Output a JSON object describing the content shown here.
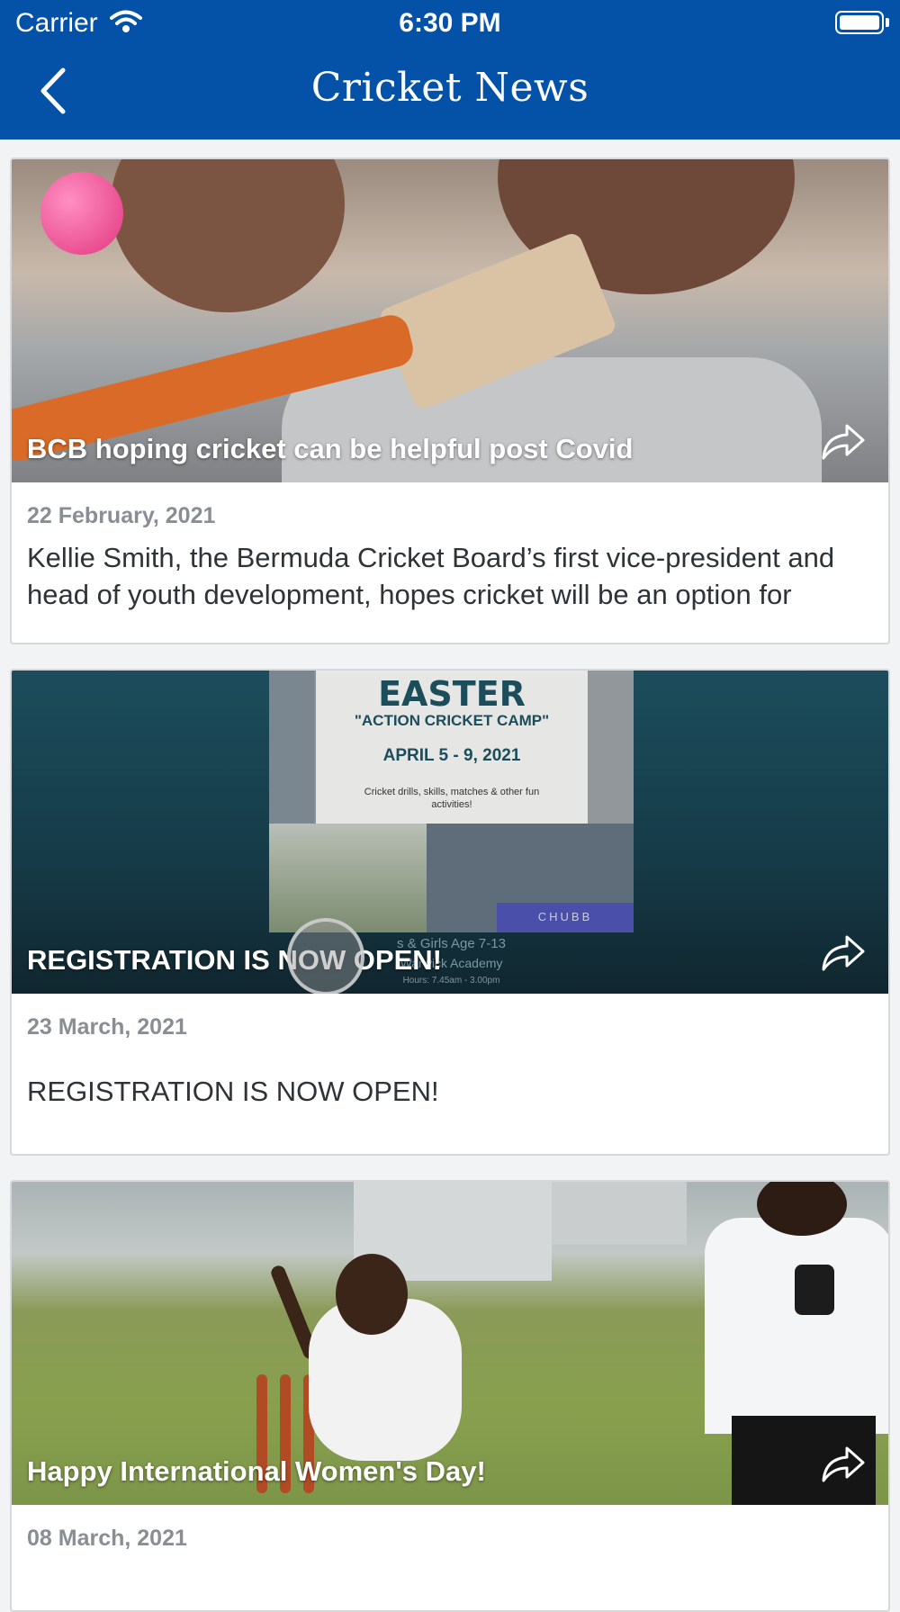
{
  "status_bar": {
    "carrier": "Carrier",
    "time": "6:30 PM"
  },
  "nav": {
    "title": "Cricket News",
    "back_icon": "chevron-left-icon"
  },
  "news": [
    {
      "image_title": "BCB hoping cricket can be helpful post Covid",
      "date": "22 February, 2021",
      "excerpt": "Kellie Smith, the Bermuda Cricket Board’s first vice-president and head of youth development, hopes cricket will be an option for"
    },
    {
      "image_title": "REGISTRATION IS NOW OPEN!",
      "date": "23 March, 2021",
      "excerpt": "REGISTRATION IS NOW OPEN!",
      "poster": {
        "heading": "EASTER",
        "camp": "\"ACTION CRICKET CAMP\"",
        "dates": "APRIL 5 - 9, 2021",
        "drills": "Cricket drills, skills, matches & other fun activities!",
        "banner": "CHUBB",
        "age": "s & Girls Age 7-13",
        "venue": "Warwick Academy",
        "hours": "Hours: 7.45am - 3.00pm"
      }
    },
    {
      "image_title": "Happy International Women's Day!",
      "date": "08 March, 2021"
    }
  ],
  "colors": {
    "header_bg": "#0352a8",
    "header_text": "#ffffff",
    "date_text": "#8a8e94",
    "body_text": "#2e3338"
  }
}
